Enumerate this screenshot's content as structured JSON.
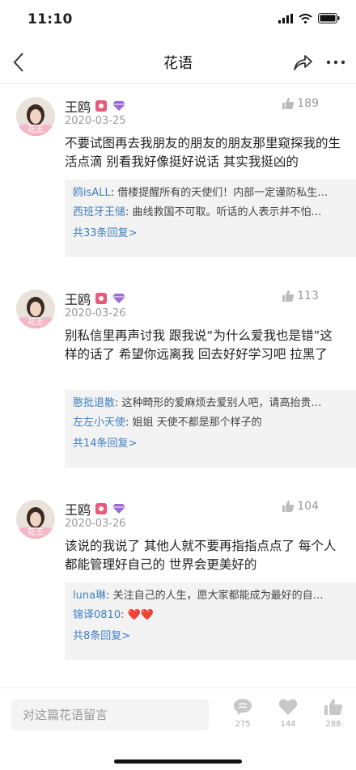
{
  "status_bar": {
    "time": "11:10"
  },
  "nav": {
    "title": "花语"
  },
  "comments": [
    {
      "avatar_badge": "花王",
      "name": "王鸥",
      "date": "2020-03-25",
      "likes": "189",
      "text": "不要试图再去我朋友的朋友的朋友那里窥探我的生活点滴 别看我好像挺好说话 其实我挺凶的",
      "replies": [
        {
          "user": "鸥isALL",
          "text": ": 借楼提醒所有的天使们！内部一定谨防私生…"
        },
        {
          "user": "西班牙王储",
          "text": ": 曲线救国不可取。听话的人表示并不怕…"
        }
      ],
      "reply_count": "共33条回复>"
    },
    {
      "avatar_badge": "花王",
      "name": "王鸥",
      "date": "2020-03-26",
      "likes": "113",
      "text": "别私信里再声讨我 跟我说“为什么爱我也是错”这样的话了 希望你远离我 回去好好学习吧 拉黑了",
      "replies": [
        {
          "user": "憨批退散",
          "text": ": 这种畸形的爱麻烦去爱别人吧，请高抬贵…"
        },
        {
          "user": "左左小天使",
          "text": ": 姐姐 天使不都是那个样子的"
        }
      ],
      "reply_count": "共14条回复>"
    },
    {
      "avatar_badge": "花王",
      "name": "王鸥",
      "date": "2020-03-26",
      "likes": "104",
      "text": "该说的我说了 其他人就不要再指指点点了 每个人都能管理好自己的 世界会更美好的",
      "replies": [
        {
          "user": "luna琳",
          "text": ": 关注自己的人生，愿大家都能成为最好的自…"
        },
        {
          "user": "锦译0810",
          "text": ": ❤️❤️"
        }
      ],
      "reply_count": "共8条回复>"
    }
  ],
  "bottom_bar": {
    "input_placeholder": "对这篇花语留言",
    "comment_count": "275",
    "favorite_count": "144",
    "like_count": "288"
  },
  "colors": {
    "link": "#3f7fc2",
    "level_badge": "#e85a7a",
    "vip_badge": "#9b6ad6",
    "avatar_badge": "#f6b6c8"
  },
  "icons": [
    "back-arrow-icon",
    "share-icon",
    "more-icon",
    "thumbs-up-icon",
    "chat-bubble-icon",
    "heart-icon"
  ]
}
